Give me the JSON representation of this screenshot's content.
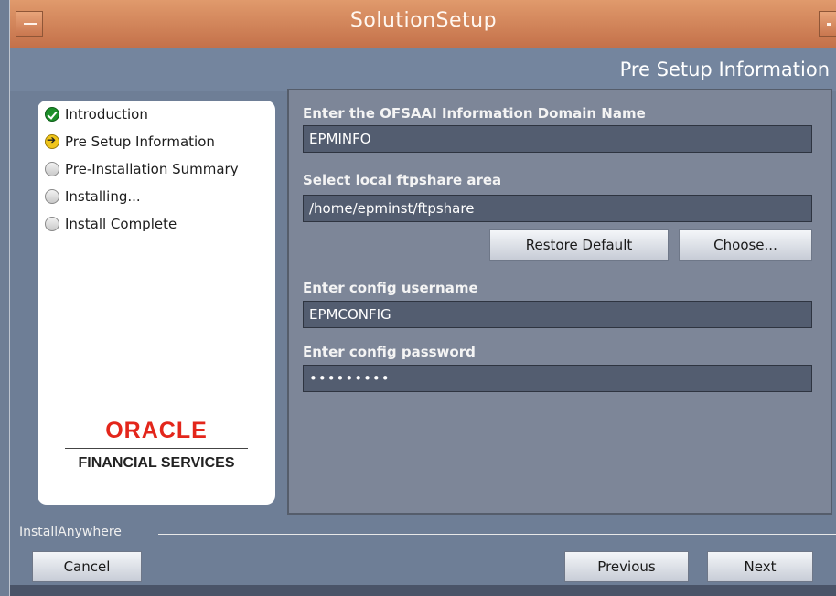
{
  "window": {
    "title": "SolutionSetup"
  },
  "header": {
    "title": "Pre Setup Information"
  },
  "steps": [
    {
      "label": "Introduction",
      "state": "done"
    },
    {
      "label": "Pre Setup Information",
      "state": "current"
    },
    {
      "label": "Pre-Installation Summary",
      "state": "pending"
    },
    {
      "label": "Installing...",
      "state": "pending"
    },
    {
      "label": "Install Complete",
      "state": "pending"
    }
  ],
  "logo": {
    "brand": "ORACLE",
    "subtitle": "FINANCIAL SERVICES"
  },
  "form": {
    "domain_label": "Enter the OFSAAI Information Domain Name",
    "domain_value": "EPMINFO",
    "ftp_label": "Select local ftpshare area",
    "ftp_value": "/home/epminst/ftpshare",
    "restore_default": "Restore Default",
    "choose": "Choose...",
    "username_label": "Enter config username",
    "username_value": "EPMCONFIG",
    "password_label": "Enter config password",
    "password_value": "•••••••••"
  },
  "footer": {
    "brand": "InstallAnywhere",
    "cancel": "Cancel",
    "previous": "Previous",
    "next": "Next"
  },
  "colors": {
    "titlebar": "#d0845a",
    "panel_bg": "#7d8698",
    "field_bg": "#535d70",
    "oracle_red": "#e3261b"
  }
}
